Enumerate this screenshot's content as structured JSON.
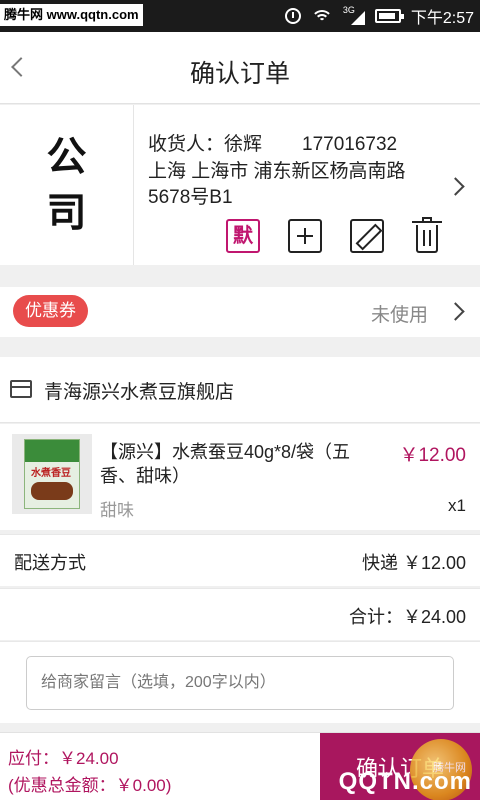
{
  "status_bar": {
    "watermark": "腾牛网 www.qqtn.com",
    "network": "3G",
    "time": "下午2:57"
  },
  "nav": {
    "title": "确认订单"
  },
  "address": {
    "company_chars": [
      "公",
      "司"
    ],
    "receiver_label": "收货人：徐辉",
    "phone": "177016732",
    "address_text": "上海 上海市 浦东新区杨高南路5678号B1",
    "default_badge": "默"
  },
  "coupon": {
    "badge": "优惠券",
    "status": "未使用"
  },
  "shop": {
    "name": "青海源兴水煮豆旗舰店"
  },
  "item": {
    "title": "【源兴】水煮蚕豆40g*8/袋（五香、甜味）",
    "price": "￥12.00",
    "variant": "甜味",
    "qty": "x1",
    "package_label": "水煮香豆"
  },
  "shipping": {
    "label": "配送方式",
    "value": "快递 ￥12.00"
  },
  "subtotal": {
    "text": "合计：￥24.00"
  },
  "message": {
    "placeholder": "给商家留言（选填，200字以内）"
  },
  "bottom": {
    "payable": "应付：￥24.00",
    "discount": "(优惠总金额：￥0.00)",
    "confirm_label": "确认订单",
    "watermark_text": "QQTN.com",
    "watermark_small": "腾牛网"
  },
  "colors": {
    "accent": "#a8175e",
    "price": "#b0155f",
    "coupon": "#e84c4c",
    "statusbar": "#1b1b1b"
  }
}
